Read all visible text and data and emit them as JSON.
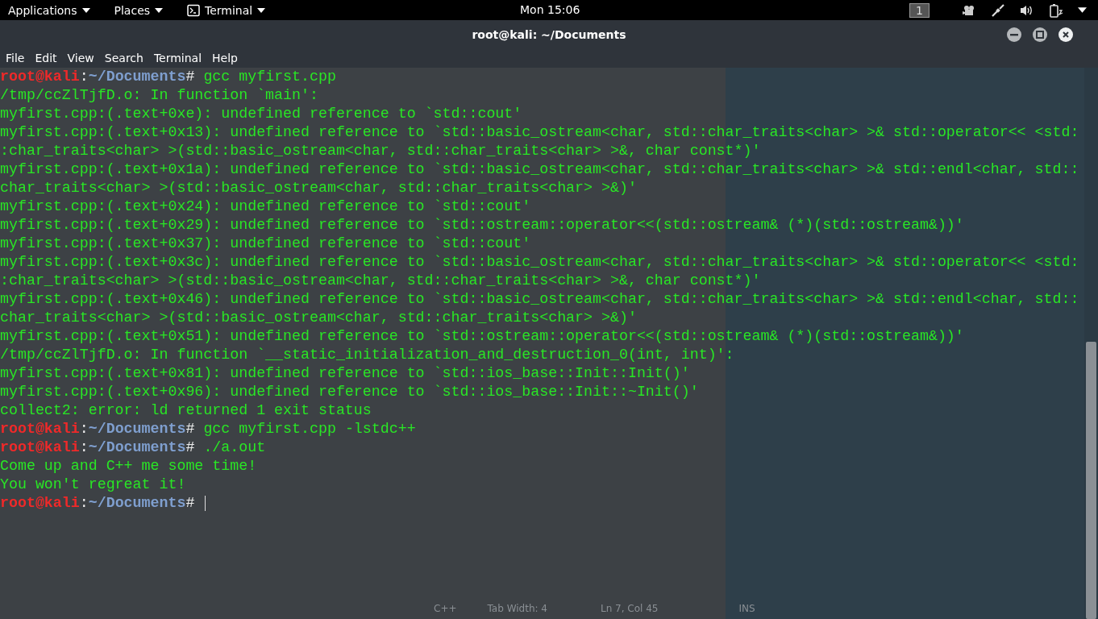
{
  "top_bar": {
    "menus": [
      "Applications",
      "Places",
      "Terminal"
    ],
    "clock": "Mon 15:06",
    "workspace": "1"
  },
  "window": {
    "title": "root@kali: ~/Documents"
  },
  "menu_bar": [
    "File",
    "Edit",
    "View",
    "Search",
    "Terminal",
    "Help"
  ],
  "terminal_lines": [
    {
      "kind": "prompt",
      "user": "root@kali",
      "sep": ":",
      "path": "~/Documents",
      "symbol": "#",
      "command": "gcc myfirst.cpp",
      "cursor": false
    },
    {
      "kind": "output",
      "text": "/tmp/ccZlTjfD.o: In function `main':"
    },
    {
      "kind": "output",
      "text": "myfirst.cpp:(.text+0xe): undefined reference to `std::cout'"
    },
    {
      "kind": "output",
      "text": "myfirst.cpp:(.text+0x13): undefined reference to `std::basic_ostream<char, std::char_traits<char> >& std::operator<< <std:"
    },
    {
      "kind": "output",
      "text": ":char_traits<char> >(std::basic_ostream<char, std::char_traits<char> >&, char const*)'"
    },
    {
      "kind": "output",
      "text": "myfirst.cpp:(.text+0x1a): undefined reference to `std::basic_ostream<char, std::char_traits<char> >& std::endl<char, std::"
    },
    {
      "kind": "output",
      "text": "char_traits<char> >(std::basic_ostream<char, std::char_traits<char> >&)'"
    },
    {
      "kind": "output",
      "text": "myfirst.cpp:(.text+0x24): undefined reference to `std::cout'"
    },
    {
      "kind": "output",
      "text": "myfirst.cpp:(.text+0x29): undefined reference to `std::ostream::operator<<(std::ostream& (*)(std::ostream&))'"
    },
    {
      "kind": "output",
      "text": "myfirst.cpp:(.text+0x37): undefined reference to `std::cout'"
    },
    {
      "kind": "output",
      "text": "myfirst.cpp:(.text+0x3c): undefined reference to `std::basic_ostream<char, std::char_traits<char> >& std::operator<< <std:"
    },
    {
      "kind": "output",
      "text": ":char_traits<char> >(std::basic_ostream<char, std::char_traits<char> >&, char const*)'"
    },
    {
      "kind": "output",
      "text": "myfirst.cpp:(.text+0x46): undefined reference to `std::basic_ostream<char, std::char_traits<char> >& std::endl<char, std::"
    },
    {
      "kind": "output",
      "text": "char_traits<char> >(std::basic_ostream<char, std::char_traits<char> >&)'"
    },
    {
      "kind": "output",
      "text": "myfirst.cpp:(.text+0x51): undefined reference to `std::ostream::operator<<(std::ostream& (*)(std::ostream&))'"
    },
    {
      "kind": "output",
      "text": "/tmp/ccZlTjfD.o: In function `__static_initialization_and_destruction_0(int, int)':"
    },
    {
      "kind": "output",
      "text": "myfirst.cpp:(.text+0x81): undefined reference to `std::ios_base::Init::Init()'"
    },
    {
      "kind": "output",
      "text": "myfirst.cpp:(.text+0x96): undefined reference to `std::ios_base::Init::~Init()'"
    },
    {
      "kind": "output",
      "text": "collect2: error: ld returned 1 exit status"
    },
    {
      "kind": "prompt",
      "user": "root@kali",
      "sep": ":",
      "path": "~/Documents",
      "symbol": "#",
      "command": "gcc myfirst.cpp -lstdc++",
      "cursor": false
    },
    {
      "kind": "prompt",
      "user": "root@kali",
      "sep": ":",
      "path": "~/Documents",
      "symbol": "#",
      "command": "./a.out",
      "cursor": false
    },
    {
      "kind": "output",
      "text": "Come up and C++ me some time!"
    },
    {
      "kind": "output",
      "text": "You won't regreat it!"
    },
    {
      "kind": "prompt",
      "user": "root@kali",
      "sep": ":",
      "path": "~/Documents",
      "symbol": "#",
      "cursor": true
    }
  ],
  "editor_status": [
    "C++",
    "Tab Width: 4",
    "Ln 7, Col 45",
    "INS"
  ]
}
